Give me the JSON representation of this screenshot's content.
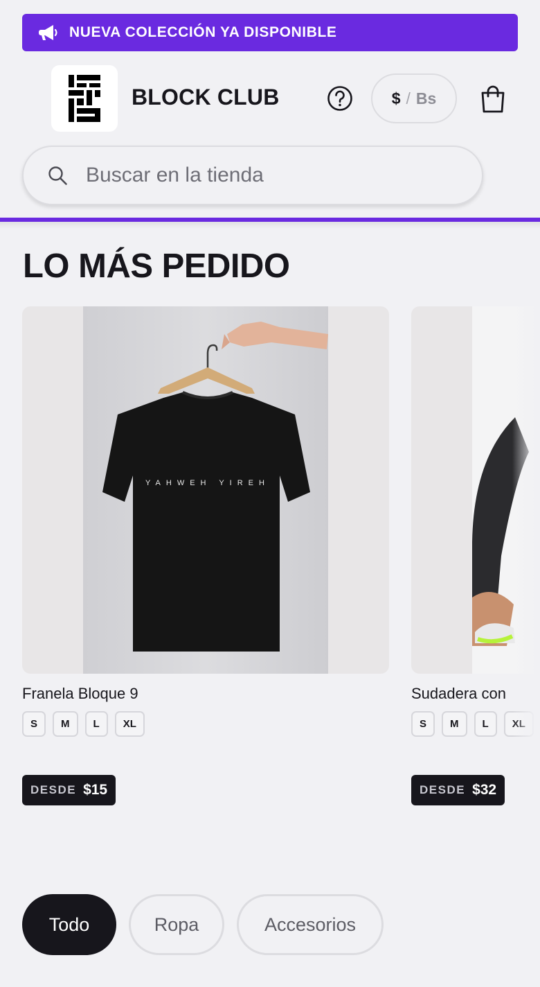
{
  "announcement": {
    "text": "NUEVA COLECCIÓN YA DISPONIBLE",
    "icon": "megaphone-icon"
  },
  "header": {
    "brand": "BLOCK CLUB",
    "help_icon": "question-circle-icon",
    "currency": {
      "usd": "$",
      "separator": "/",
      "bs": "Bs"
    },
    "cart_icon": "shopping-bag-icon"
  },
  "search": {
    "placeholder": "Buscar en la tienda",
    "value": "",
    "icon": "search-icon"
  },
  "section": {
    "title": "LO MÁS PEDIDO"
  },
  "products": [
    {
      "name": "Franela Bloque 9",
      "sizes": [
        "S",
        "M",
        "L",
        "XL"
      ],
      "price_label": "DESDE",
      "price": "$15",
      "shirt_print": "YAHWEH YIREH"
    },
    {
      "name": "Sudadera con",
      "sizes": [
        "S",
        "M",
        "L",
        "XL"
      ],
      "price_label": "DESDE",
      "price": "$32"
    }
  ],
  "filters": [
    {
      "label": "Todo",
      "active": true
    },
    {
      "label": "Ropa",
      "active": false
    },
    {
      "label": "Accesorios",
      "active": false
    }
  ],
  "colors": {
    "accent": "#6a2ae0",
    "dark": "#17161c",
    "background": "#f1f1f4"
  }
}
